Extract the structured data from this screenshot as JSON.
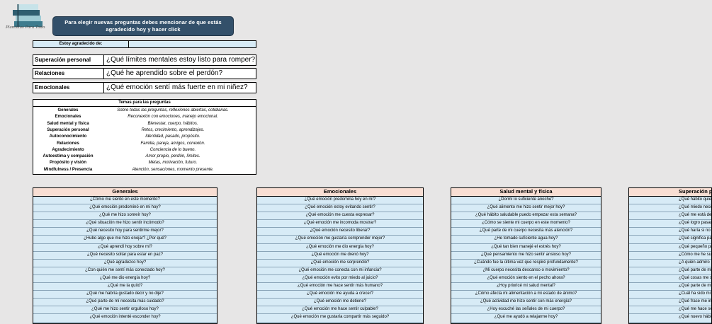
{
  "logo": {
    "text": "Plantillas Para Todo"
  },
  "banner": {
    "text": "Para elegir nuevas preguntas debes mencionar de que estás agradecido hoy y hacer click"
  },
  "gratitude": {
    "label": "Estoy agradecido de:",
    "value": ""
  },
  "questions": [
    {
      "category": "Superación personal",
      "question": "¿Qué límites mentales estoy listo para romper?"
    },
    {
      "category": "Relaciones",
      "question": "¿Qué he aprendido sobre el perdón?"
    },
    {
      "category": "Emocionales",
      "question": "¿Qué emoción sentí más fuerte en mi niñez?"
    }
  ],
  "themes": {
    "title": "Temas para las preguntas",
    "rows": [
      {
        "name": "Generales",
        "desc": "Sobre todas las preguntas, reflexiones abiertas, cotidianas."
      },
      {
        "name": "Emocionales",
        "desc": "Reconexión con emociones, manejo emocional."
      },
      {
        "name": "Salud mental y física",
        "desc": "Bienestar, cuerpo, hábitos."
      },
      {
        "name": "Superación personal",
        "desc": "Retos, crecimiento, aprendizajes."
      },
      {
        "name": "Autoconocimiento",
        "desc": "Identidad, pasado, propósito."
      },
      {
        "name": "Relaciones",
        "desc": "Familia, pareja, amigos, conexión."
      },
      {
        "name": "Agradecimiento",
        "desc": "Conciencia de lo bueno."
      },
      {
        "name": "Autoestima y compasión",
        "desc": "Amor propio, perdón, límites."
      },
      {
        "name": "Propósito y visión",
        "desc": "Metas, motivación, futuro."
      },
      {
        "name": "Mindfulness / Presencia",
        "desc": "Atención, sensaciones, momento presente."
      }
    ]
  },
  "tables": [
    {
      "title": "Generales",
      "rows": [
        "¿Cómo me siento en este momento?",
        "¿Qué emoción predominó en mi hoy?",
        "¿Qué me hizo sonreír hoy?",
        "¿Qué situación me hizo sentir incómodo?",
        "¿Qué necesito hoy para sentirme mejor?",
        "¿Hubo algo que me hizo enojar? ¿Por qué?",
        "¿Qué aprendí hoy sobre mí?",
        "¿Qué necesito soltar para estar en paz?",
        "¿Qué agradezco hoy?",
        "¿Con quién me sentí más conectado hoy?",
        "¿Qué me dio energía hoy?",
        "¿Qué me la quitó?",
        "¿Qué me habría gustado decir y no dije?",
        "¿Qué parte de mí necesita más cuidado?",
        "¿Qué me hizo sentir orgulloso hoy?",
        "¿Qué emoción intenté esconder hoy?",
        "¿Cómo se siente mi cuerpo ahora?"
      ]
    },
    {
      "title": "Emocionales",
      "rows": [
        "¿Qué emoción predomina hoy en mí?",
        "¿Qué emoción estoy evitando sentir?",
        "¿Qué emoción me cuesta expresar?",
        "¿Qué emoción me incomoda mostrar?",
        "¿Qué emoción necesito liberar?",
        "¿Qué emoción me gustaría comprender mejor?",
        "¿Qué emoción me dio energía hoy?",
        "¿Qué emoción me drenó hoy?",
        "¿Qué emoción me sorprendió?",
        "¿Qué emoción me conecta con mi infancia?",
        "¿Qué emoción evito por miedo al juicio?",
        "¿Qué emoción me hace sentir más humano?",
        "¿Qué emoción me ayuda a crecer?",
        "¿Qué emoción me detiene?",
        "¿Qué emoción me hace sentir culpable?",
        "¿Qué emoción me gustaría compartir más seguido?",
        "¿Qué emoción asocio con el amor?"
      ]
    },
    {
      "title": "Salud mental y física",
      "rows": [
        "¿Dormí lo suficiente anoche?",
        "¿Qué alimento me hizo sentir mejor hoy?",
        "¿Qué hábito saludable puedo empezar esta semana?",
        "¿Cómo se siente mi cuerpo en este momento?",
        "¿Qué parte de mi cuerpo necesita más atención?",
        "¿He tomado suficiente agua hoy?",
        "¿Qué tan bien manejé el estrés hoy?",
        "¿Qué pensamiento me hizo sentir ansioso hoy?",
        "¿Cuándo fue la última vez que respiré profundamente?",
        "¿Mi cuerpo necesita descanso o movimiento?",
        "¿Qué emoción siento en el pecho ahora?",
        "¿Hoy prioricé mi salud mental?",
        "¿Cómo afecta mi alimentación a mi estado de ánimo?",
        "¿Qué actividad me hizo sentir con más energía?",
        "¿Hoy escuché las señales de mi cuerpo?",
        "¿Qué me ayudó a relajarme hoy?",
        "¿Qué pensamiento me trajo paz hoy?"
      ]
    },
    {
      "title": "Superación p",
      "rows": [
        "¿Qué hábito quiero elim",
        "¿Qué miedo necesito",
        "¿Qué me está detenie",
        "¿Qué logro pasado me recu",
        "¿Qué haría si no tu",
        "¿Qué significa para",
        "¿Qué pequeño paso puedo d",
        "¿Cómo me he superado",
        "¿A quién admiro",
        "¿Qué parte de mi rutina m",
        "¿Qué cosas me sabotean",
        "¿Qué parte de mí necesit",
        "¿Cuál ha sido mi momer",
        "¿Qué frase me inspira a",
        "¿Qué me hace ser",
        "¿Qué nuevo hábito me harí",
        "¿Qué me enseñó mi"
      ]
    }
  ],
  "colors": {
    "banner": "#33506a",
    "cell": "#d7ebf6",
    "header": "#f8ded3",
    "page": "#e7e6e6"
  }
}
